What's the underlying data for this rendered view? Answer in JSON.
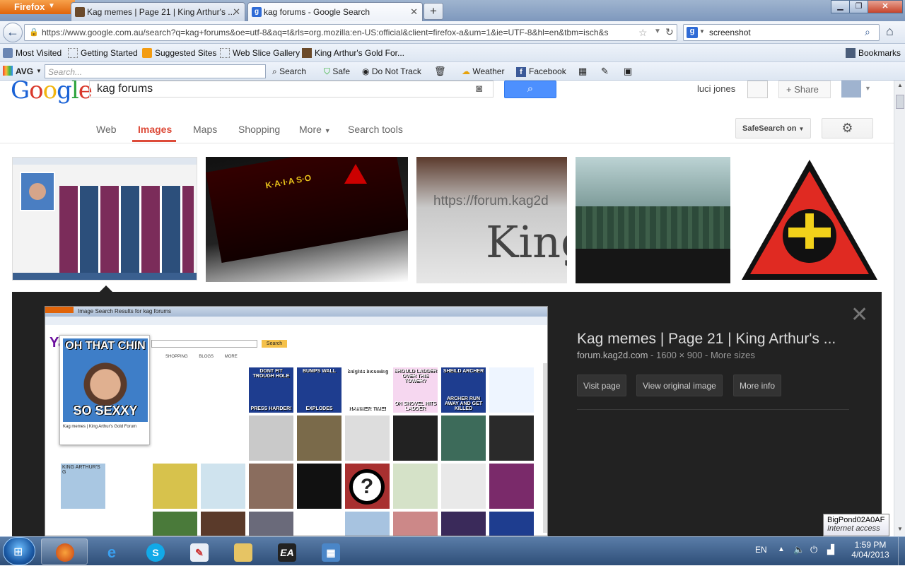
{
  "browser": {
    "menu_label": "Firefox",
    "tabs": [
      {
        "title": "Kag memes | Page 21 | King Arthur's ..."
      },
      {
        "title": "kag forums - Google Search"
      }
    ],
    "new_tab": "+",
    "url": "https://www.google.com.au/search?q=kag+forums&oe=utf-8&aq=t&rls=org.mozilla:en-US:official&client=firefox-a&um=1&ie=UTF-8&hl=en&tbm=isch&s",
    "search_engine_query": "screenshot",
    "bookmarks": [
      "Most Visited",
      "Getting Started",
      "Suggested Sites",
      "Web Slice Gallery",
      "King Arthur's Gold For..."
    ],
    "bookmarks_menu": "Bookmarks"
  },
  "avg": {
    "brand": "AVG",
    "search_placeholder": "Search...",
    "search_button": "Search",
    "safe": "Safe",
    "do_not_track": "Do Not Track",
    "weather": "Weather",
    "facebook": "Facebook"
  },
  "google": {
    "logo": "Google",
    "query": "kag forums",
    "user": "luci jones",
    "share": "+ Share",
    "tabs": [
      "Web",
      "Images",
      "Maps",
      "Shopping",
      "More",
      "Search tools"
    ],
    "selected_tab": "Images",
    "safesearch": "SafeSearch on",
    "thumbnails": [
      "kag memes screenshot",
      "kag-clan-banner",
      "forum.kag2d url closeup",
      "kag game scene",
      "red triangle logo"
    ]
  },
  "panel": {
    "title": "Kag memes | Page 21 | King Arthur's ...",
    "domain": "forum.kag2d.com",
    "details": " - 1600 × 900 - More sizes",
    "buttons": [
      "Visit page",
      "View original image",
      "More info"
    ],
    "preview": {
      "tab_title": "Image Search Results for kag forums",
      "site": "Yahoo!",
      "search_btn": "Search",
      "nav": [
        "SHOPPING",
        "BLOGS",
        "MORE"
      ],
      "meme_top": "OH THAT CHIN",
      "meme_bottom": "SO SEXXY",
      "popup_caption": "Kag memes | King Arthur's Gold Forum",
      "cells": [
        {
          "top": "DONT FIT TROUGH HOLE",
          "bottom": "PRESS HARDER!"
        },
        {
          "top": "BUMPS WALL",
          "bottom": "EXPLODES"
        },
        {
          "top": "knights incoming",
          "bottom": "HAMMER TIME!"
        },
        {
          "top": "SHOULD LADDER OVER THIS TOWER?",
          "bottom": "OH SHOVEL HITS LADDER"
        },
        {
          "top": "SHEILD ARCHER",
          "bottom": "ARCHER RUN AWAY AND GET KILLED"
        }
      ],
      "kag_text": "KING ARTHUR'S G"
    }
  },
  "taskbar": {
    "lang": "EN",
    "time": "1:59 PM",
    "date": "4/04/2013",
    "tooltip_line1": "BigPond02A0AF",
    "tooltip_line2": "Internet access"
  }
}
